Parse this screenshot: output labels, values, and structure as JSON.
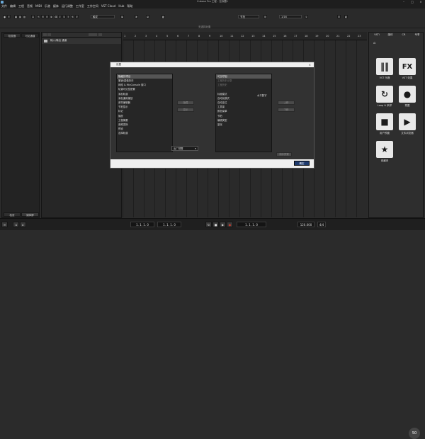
{
  "window": {
    "title": "Cubase Pro 工程 - 无标题1",
    "app_right": "Cubase Pro"
  },
  "menu": [
    "文件",
    "编辑",
    "工程",
    "音频",
    "MIDI",
    "乐谱",
    "媒体",
    "运行调整",
    "工作室",
    "工作空间",
    "VST Cloud",
    "Hub",
    "帮助"
  ],
  "toolbar": {
    "mode_value": "触发",
    "grid_value": "节拍",
    "quantize_value": "1/16",
    "snap_mode": "按小节"
  },
  "info_line": "无选择对象",
  "left_panel": {
    "tab_left": "检查器",
    "tab_right": "可见通道",
    "folder_row": "输入/输出 通道",
    "bottom_left": "检查",
    "bottom_right": "媒体屏"
  },
  "ruler": {
    "marks": [
      "1",
      "2",
      "3",
      "4",
      "5",
      "6",
      "7",
      "8",
      "9",
      "10",
      "11",
      "12",
      "13",
      "14",
      "15",
      "16",
      "17",
      "18",
      "19",
      "20",
      "21",
      "22",
      "23"
    ]
  },
  "right_panel": {
    "tabs": [
      "VSTi",
      "媒体",
      "CR",
      "专享"
    ],
    "items": [
      {
        "label": "VST 乐器",
        "glyph": "‖‖",
        "icon": "piano-icon"
      },
      {
        "label": "VST 效果",
        "glyph": "FX",
        "icon": "fx-icon"
      },
      {
        "label": "Loop & 采样",
        "glyph": "↻",
        "icon": "loop-icon"
      },
      {
        "label": "预置",
        "glyph": "●",
        "icon": "preset-icon"
      },
      {
        "label": "用户预置",
        "glyph": "■",
        "icon": "user-preset-icon"
      },
      {
        "label": "文件浏览器",
        "glyph": "▶",
        "icon": "file-browser-icon"
      },
      {
        "label": "收藏夹",
        "glyph": "★",
        "icon": "star-icon"
      }
    ]
  },
  "transport": {
    "left_pos": "1. 1. 1. 0",
    "right_pos": "1. 1. 1. 0",
    "end_pos": "1. 1. 1. 0",
    "tempo": "120.000",
    "sig": "4/4",
    "zoom": "50"
  },
  "dialog": {
    "title": "设置",
    "left_header": "隐藏的项目",
    "left_items": [
      "撤销/重做历史",
      "网络 & MixConsole 窗口",
      "轨道可见性配置",
      "添加轨道",
      "添加通用播放",
      "音符编辑器",
      "节拍显示",
      "标记",
      "播放",
      "工程摘要",
      "音频变换",
      "预设",
      "选择轨道"
    ],
    "right_header": "可见项目",
    "right_items": [
      "工程历史记录",
      "工程历史",
      "",
      "标准模式",
      "自动化模式",
      "自动定位",
      "工具架",
      "颜色菜单",
      "节拍",
      "编辑类型",
      "量化"
    ],
    "right_right_note": "水平数字",
    "btn_show": "隐藏",
    "btn_hide": "显示",
    "btn_up": "上移",
    "btn_down": "下移",
    "preset_value": "出厂预置",
    "btn_save_preset": "储存预置",
    "ok_label": "确定"
  },
  "colors": {
    "accent": "#1e3a6e",
    "record": "#c0392b",
    "window": "#2b2b2b"
  }
}
